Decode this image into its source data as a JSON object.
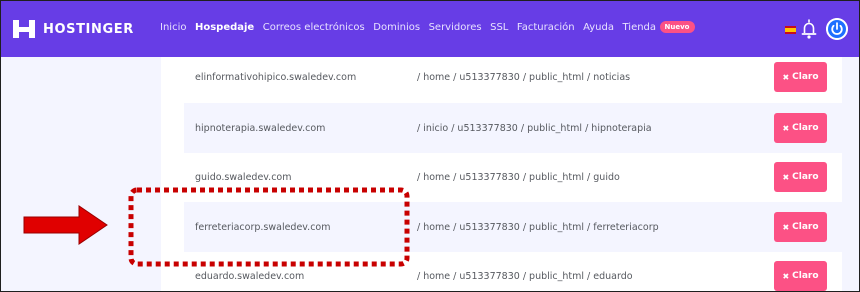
{
  "header": {
    "logo_text": "HOSTINGER",
    "nav": [
      {
        "label": "Inicio",
        "active": false
      },
      {
        "label": "Hospedaje",
        "active": true
      },
      {
        "label": "Correos electrónicos",
        "active": false
      },
      {
        "label": "Dominios",
        "active": false
      },
      {
        "label": "Servidores",
        "active": false
      },
      {
        "label": "SSL",
        "active": false
      },
      {
        "label": "Facturación",
        "active": false
      },
      {
        "label": "Ayuda",
        "active": false
      },
      {
        "label": "Tienda",
        "active": false
      }
    ],
    "new_badge": "Nuevo"
  },
  "rows": [
    {
      "domain": "elinformativohipico.swaledev.com",
      "path": "/ home / u513377830 / public_html / noticias",
      "button": "Claro"
    },
    {
      "domain": "hipnoterapia.swaledev.com",
      "path": "/ inicio / u513377830 / public_html / hipnoterapia",
      "button": "Claro"
    },
    {
      "domain": "guido.swaledev.com",
      "path": "/ home / u513377830 / public_html / guido",
      "button": "Claro"
    },
    {
      "domain": "ferreteriacorp.swaledev.com",
      "path": "/ home / u513377830 / public_html / ferreteriacorp",
      "button": "Claro"
    },
    {
      "domain": "eduardo.swaledev.com",
      "path": "/ home / u513377830 / public_html / eduardo",
      "button": "Claro"
    }
  ],
  "colors": {
    "brand_purple": "#673de6",
    "clear_button": "#fc5185",
    "row_alt": "#f4f5ff",
    "annotation_red": "#e00000"
  },
  "icons": {
    "logo": "hostinger-logo-icon",
    "flag": "spain-flag-icon",
    "bell": "bell-icon",
    "power": "power-icon",
    "close": "x-icon",
    "arrow": "arrow-right-icon"
  }
}
